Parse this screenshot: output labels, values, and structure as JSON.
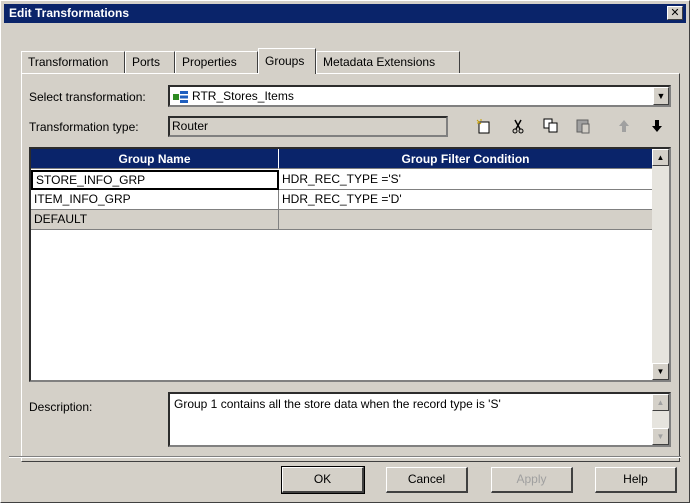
{
  "window": {
    "title": "Edit Transformations",
    "close_glyph": "✕"
  },
  "tabs": [
    {
      "label": "Transformation"
    },
    {
      "label": "Ports"
    },
    {
      "label": "Properties"
    },
    {
      "label": "Groups",
      "active": true
    },
    {
      "label": "Metadata Extensions"
    }
  ],
  "select_transformation": {
    "label": "Select transformation:",
    "value": "RTR_Stores_Items",
    "icon": "router-transformation-icon"
  },
  "transformation_type": {
    "label": "Transformation type:",
    "value": "Router"
  },
  "toolbar": {
    "new": "new-group-icon",
    "cut": "cut-icon",
    "copy": "copy-icon",
    "paste": "paste-icon",
    "up": "move-up-icon",
    "down": "move-down-icon"
  },
  "grid": {
    "columns": [
      "Group Name",
      "Group Filter Condition"
    ],
    "rows": [
      [
        "STORE_INFO_GRP",
        "HDR_REC_TYPE ='S'"
      ],
      [
        "ITEM_INFO_GRP",
        "HDR_REC_TYPE ='D'"
      ],
      [
        "DEFAULT",
        ""
      ]
    ]
  },
  "description": {
    "label": "Description:",
    "value": "Group 1 contains all the store data when the record type is 'S'"
  },
  "buttons": {
    "ok": "OK",
    "cancel": "Cancel",
    "apply": "Apply",
    "help": "Help"
  },
  "colors": {
    "titlebar": "#0a246a",
    "face": "#d4d0c8",
    "header": "#0a246a"
  }
}
